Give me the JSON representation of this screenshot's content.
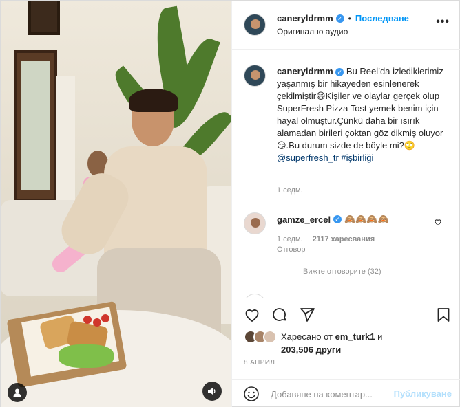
{
  "header": {
    "username": "caneryldrmm",
    "separator": "•",
    "follow_label": "Последване",
    "audio": "Оригинално аудио",
    "more": "•••"
  },
  "caption": {
    "username": "caneryldrmm",
    "text": "Bu Reel’da izlediklerimiz yaşanmış bir hikayeden esinlenerek çekilmiştir😄Kişiler ve olaylar gerçek olup SuperFresh Pizza Tost yemek benim için hayal olmuştur.Çünkü daha bir ısırık alamadan birileri çoktan göz dikmiş oluyor😏.Bu durum sizde de böyle mi?🙄 ",
    "mention": "@superfresh_tr",
    "hashtag": "#işbirliği",
    "time": "1 седм."
  },
  "comment": {
    "username": "gamze_ercel",
    "text": "🙈🙈🙈🙈",
    "time": "1 седм.",
    "likes": "2117 харесвания",
    "reply": "Отговор",
    "view_replies": "Вижте отговорите (32)"
  },
  "actions": {
    "liked_prefix": "Харесано от",
    "liked_user": "em_turk1",
    "liked_and": "и",
    "liked_others": "203,506 други",
    "date": "8 АПРИЛ"
  },
  "add_comment": {
    "placeholder": "Добавяне на коментар...",
    "post_label": "Публикуване"
  },
  "icons": {
    "verified": "verified-badge-icon",
    "like": "heart-icon",
    "comment": "comment-bubble-icon",
    "share": "paper-plane-icon",
    "save": "bookmark-icon",
    "emoji": "smiley-icon",
    "sound": "speaker-icon",
    "user_tag": "user-icon"
  },
  "colors": {
    "accent": "#0095f6",
    "link": "#00376b",
    "muted": "#8e8e8e",
    "post_disabled": "#b2dffc"
  }
}
